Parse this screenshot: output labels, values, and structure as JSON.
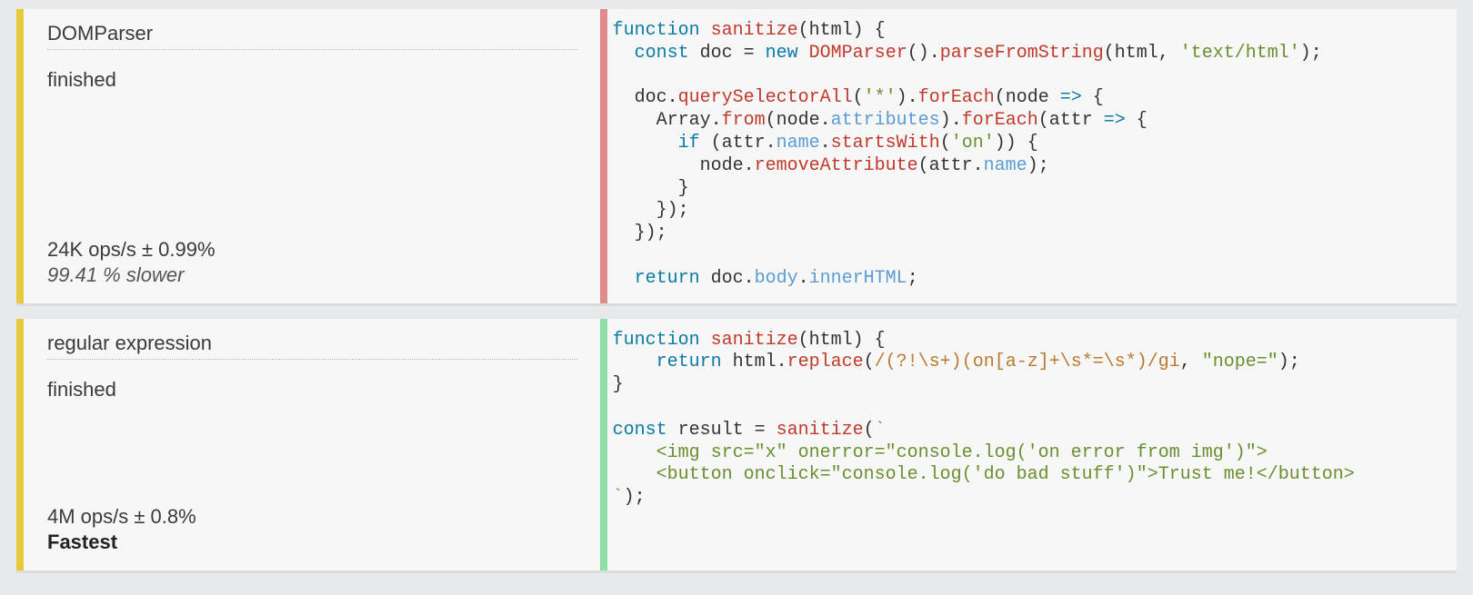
{
  "cards": [
    {
      "accent": "yellow",
      "title": "DOMParser",
      "status": "finished",
      "ops": "24K ops/s ± 0.99%",
      "note": "99.41 % slower",
      "noteKind": "slower",
      "codebar": "red",
      "code": {
        "l1_kw_function": "function",
        "l1_fn": "sanitize",
        "l1_rest": "(html) {",
        "l2_kw_const": "const",
        "l2_doc": " doc ",
        "l2_eq": "=",
        "l2_kw_new": " new",
        "l2_fn1": " DOMParser",
        "l2_mid": "().",
        "l2_fn2": "parseFromString",
        "l2_paren": "(html, ",
        "l2_str": "'text/html'",
        "l2_end": ");",
        "l4_a": "  doc.",
        "l4_fn": "querySelectorAll",
        "l4_b": "(",
        "l4_str": "'*'",
        "l4_c": ").",
        "l4_fn2": "forEach",
        "l4_d": "(node ",
        "l4_arrow": "=>",
        "l4_e": " {",
        "l5_a": "    Array.",
        "l5_fn": "from",
        "l5_b": "(node.",
        "l5_prop": "attributes",
        "l5_c": ").",
        "l5_fn2": "forEach",
        "l5_d": "(attr ",
        "l5_arrow": "=>",
        "l5_e": " {",
        "l6_a": "      ",
        "l6_kw": "if",
        "l6_b": " (attr.",
        "l6_prop": "name",
        "l6_c": ".",
        "l6_fn": "startsWith",
        "l6_d": "(",
        "l6_str": "'on'",
        "l6_e": ")) {",
        "l7_a": "        node.",
        "l7_fn": "removeAttribute",
        "l7_b": "(attr.",
        "l7_prop": "name",
        "l7_c": ");",
        "l8": "      }",
        "l9": "    });",
        "l10": "  });",
        "l12_kw": "  return",
        "l12_a": " doc.",
        "l12_prop1": "body",
        "l12_b": ".",
        "l12_prop2": "innerHTML",
        "l12_c": ";"
      }
    },
    {
      "accent": "yellow",
      "title": "regular expression",
      "status": "finished",
      "ops": "4M ops/s ± 0.8%",
      "note": "Fastest",
      "noteKind": "fastest",
      "codebar": "green",
      "code": {
        "l1_kw_function": "function",
        "l1_fn": "sanitize",
        "l1_rest": "(html) {",
        "l2_kw": "    return",
        "l2_a": " html.",
        "l2_fn": "replace",
        "l2_b": "(",
        "l2_regex": "/(?!\\s+)(on[a-z]+\\s*=\\s*)/gi",
        "l2_c": ", ",
        "l2_str": "\"nope=\"",
        "l2_d": ");",
        "l3": "}",
        "l5_kw": "const",
        "l5_a": " result ",
        "l5_eq": "=",
        "l5_b": " ",
        "l5_fn": "sanitize",
        "l5_c": "(",
        "l5_tick": "`",
        "l6": "    <img src=\"x\" onerror=\"console.log('on error from img')\">",
        "l7": "    <button onclick=\"console.log('do bad stuff')\">Trust me!</button>",
        "l8_tick": "`",
        "l8_end": ");"
      }
    }
  ]
}
